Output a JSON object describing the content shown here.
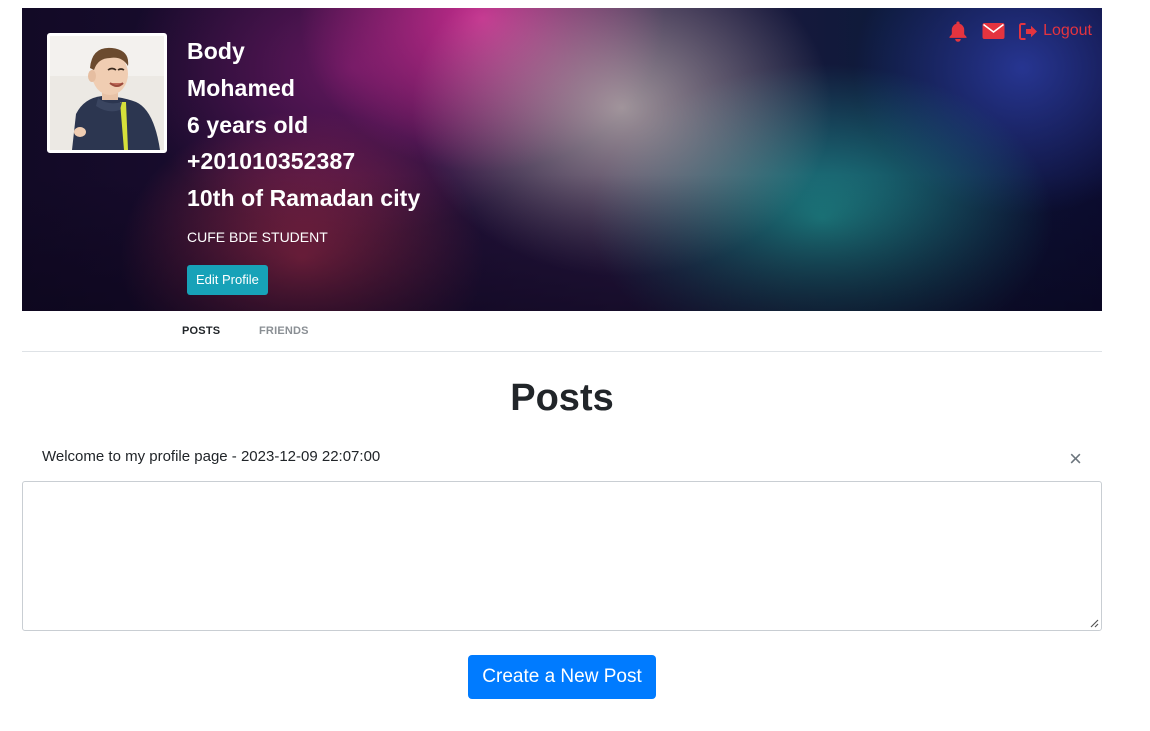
{
  "profile": {
    "first_name": "Body",
    "last_name": "Mohamed",
    "age": "6 years old",
    "phone": "+201010352387",
    "city": "10th of Ramadan city",
    "bio": "CUFE BDE STUDENT",
    "edit_label": "Edit Profile"
  },
  "header_icons": {
    "notifications": "bell-icon",
    "messages": "envelope-icon",
    "logout_icon": "sign-out-icon",
    "logout_label": "Logout",
    "accent": "#e4343f"
  },
  "tabs": [
    {
      "label": "Posts",
      "active": true
    },
    {
      "label": "Friends",
      "active": false
    }
  ],
  "posts": {
    "title": "Posts",
    "items": [
      {
        "text": "Welcome to my profile page - 2023-12-09 22:07:00",
        "close": "×"
      }
    ],
    "input_value": "",
    "input_placeholder": "",
    "create_label": "Create a New Post"
  },
  "colors": {
    "primary": "#007bff",
    "info": "#17a2b8"
  }
}
